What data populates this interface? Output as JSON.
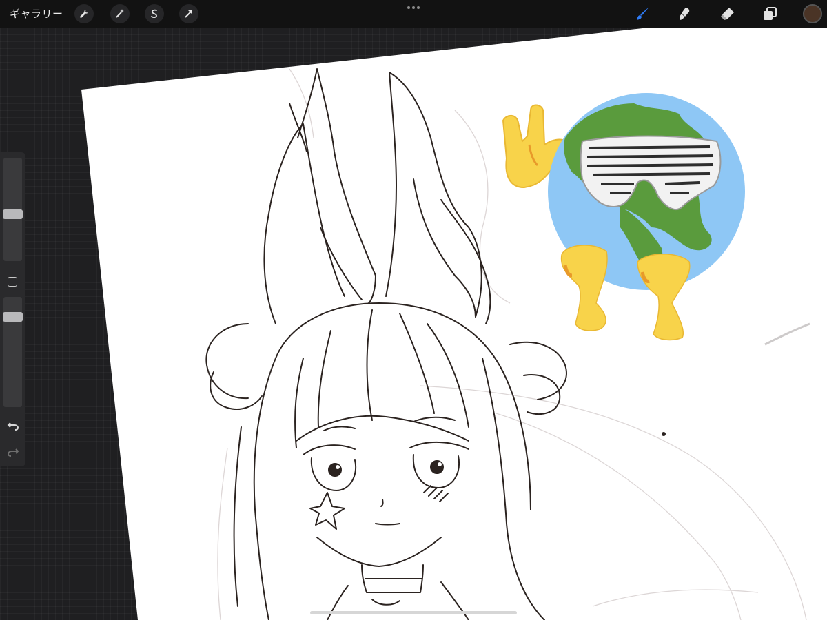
{
  "toolbar": {
    "gallery_label": "ギャラリー",
    "left_tools": [
      {
        "icon": "wrench-icon"
      },
      {
        "icon": "magic-wand-icon"
      },
      {
        "icon": "selection-icon"
      },
      {
        "icon": "transform-arrow-icon"
      }
    ],
    "right_tools": [
      {
        "icon": "brush-icon",
        "active": true
      },
      {
        "icon": "smudge-icon"
      },
      {
        "icon": "eraser-icon"
      },
      {
        "icon": "layers-icon"
      }
    ],
    "active_color": "#4a3426",
    "active_tool_color": "#2f7cf6"
  },
  "sidebar": {
    "brush_size_level": 0.45,
    "opacity_level": 0.15
  },
  "canvas": {
    "paper_color": "#ffffff",
    "sketch_color": "#2b2320",
    "sticker_icons": [
      "rock-hand-icon",
      "earth-globe-icon",
      "shutter-shades-icon"
    ]
  }
}
